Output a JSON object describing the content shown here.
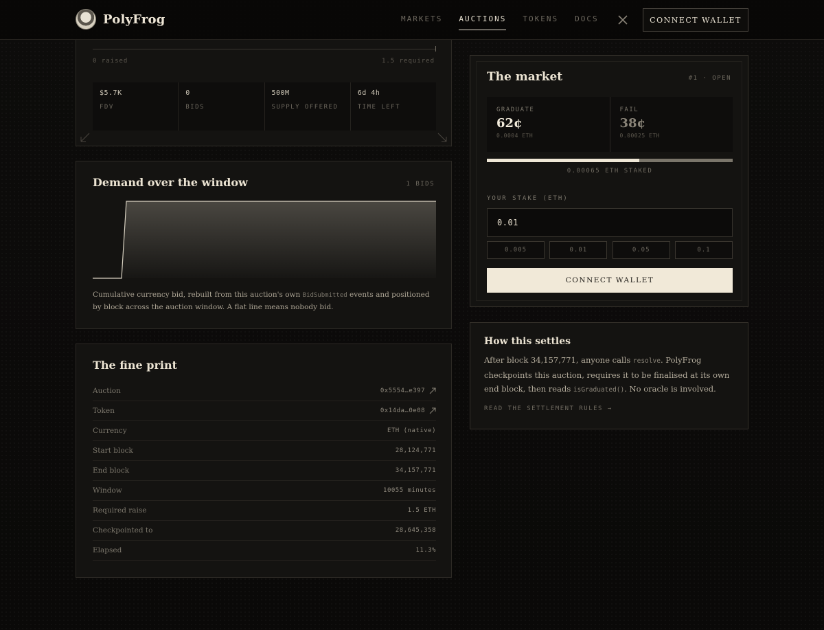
{
  "header": {
    "logo_text": "PolyFrog",
    "nav": [
      {
        "label": "MARKETS"
      },
      {
        "label": "AUCTIONS"
      },
      {
        "label": "TOKENS"
      },
      {
        "label": "DOCS"
      }
    ],
    "active_nav": "AUCTIONS",
    "connect_label": "CONNECT WALLET"
  },
  "auction": {
    "raised_label": "0 raised",
    "required_label": "1.5 required",
    "progress_fraction": 0.0,
    "stats": [
      {
        "value": "$5.7K",
        "label": "FDV"
      },
      {
        "value": "0",
        "label": "BIDS"
      },
      {
        "value": "500M",
        "label": "SUPPLY OFFERED"
      },
      {
        "value": "6d 4h",
        "label": "TIME LEFT"
      }
    ]
  },
  "demand": {
    "title": "Demand over the window",
    "bids_count": "1 BIDS",
    "caption_pre": "Cumulative currency bid, rebuilt from this auction's own ",
    "caption_code": "BidSubmitted",
    "caption_post": " events and positioned by block across the auction window. A flat line means nobody bid."
  },
  "fine_print": {
    "title": "The fine print",
    "rows": [
      {
        "key": "Auction",
        "value": "0x5554…e397",
        "link": true
      },
      {
        "key": "Token",
        "value": "0x14da…0e08",
        "link": true
      },
      {
        "key": "Currency",
        "value": "ETH (native)",
        "link": false
      },
      {
        "key": "Start block",
        "value": "28,124,771",
        "link": false
      },
      {
        "key": "End block",
        "value": "34,157,771",
        "link": false
      },
      {
        "key": "Window",
        "value": "10055 minutes",
        "link": false
      },
      {
        "key": "Required raise",
        "value": "1.5 ETH",
        "link": false
      },
      {
        "key": "Checkpointed to",
        "value": "28,645,358",
        "link": false
      },
      {
        "key": "Elapsed",
        "value": "11.3%",
        "link": false
      }
    ]
  },
  "market": {
    "title": "The market",
    "status": "#1 · OPEN",
    "graduate": {
      "label": "GRADUATE",
      "price": "62¢",
      "eth": "0.0004 ETH"
    },
    "fail": {
      "label": "FAIL",
      "price": "38¢",
      "eth": "0.00025 ETH"
    },
    "graduate_share": 0.62,
    "staked_text": "0.00065 ETH STAKED",
    "stake_label": "YOUR STAKE (ETH)",
    "stake_value": "0.01",
    "presets": [
      "0.005",
      "0.01",
      "0.05",
      "0.1"
    ],
    "connect_label": "CONNECT WALLET"
  },
  "settles": {
    "title": "How this settles",
    "body_1": "After block 34,157,771, anyone calls ",
    "code_1": "resolve",
    "body_2": ". PolyFrog checkpoints this auction, requires it to be finalised at its own end block, then reads ",
    "code_2": "isGraduated()",
    "body_3": ". No oracle is involved.",
    "link_label": "READ THE SETTLEMENT RULES →"
  }
}
